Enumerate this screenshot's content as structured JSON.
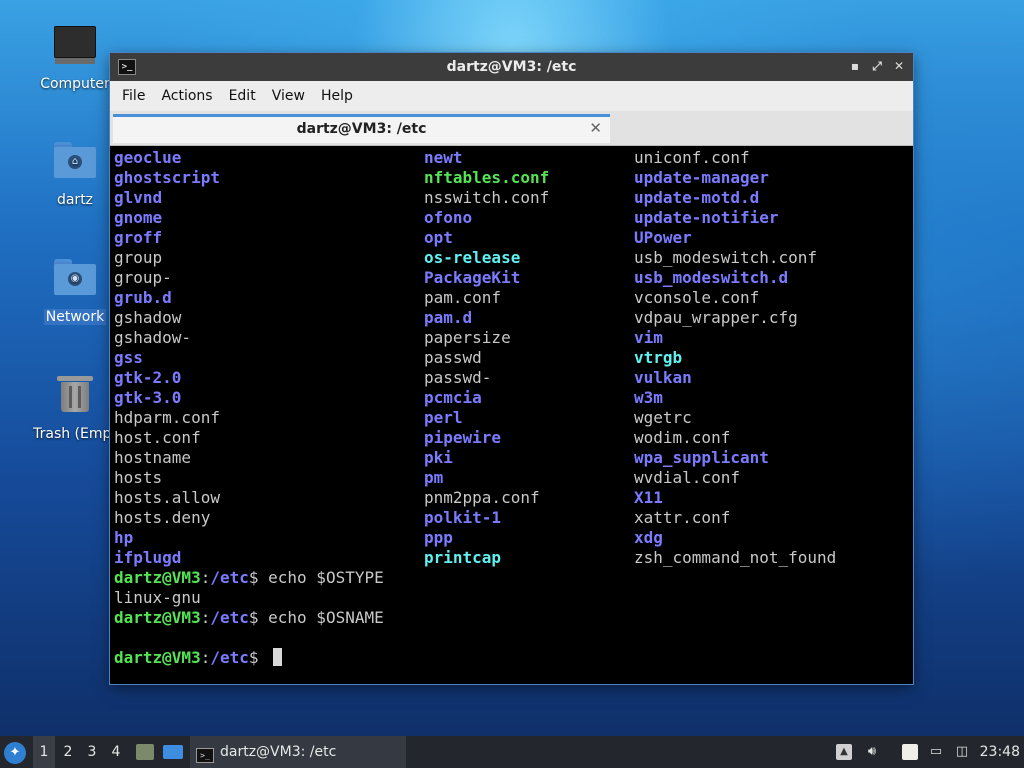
{
  "desktop": {
    "icons": [
      {
        "label": "Computer"
      },
      {
        "label": "dartz"
      },
      {
        "label": "Network"
      },
      {
        "label": "Trash (Empt"
      }
    ]
  },
  "window": {
    "title": "dartz@VM3: /etc",
    "controls": {
      "minimize": "▪",
      "maximize": "⤢",
      "close": "✕"
    },
    "menu": [
      "File",
      "Actions",
      "Edit",
      "View",
      "Help"
    ],
    "tab": {
      "title": "dartz@VM3: /etc",
      "close": "✕"
    }
  },
  "terminal": {
    "ls_columns": [
      [
        {
          "name": "geoclue",
          "type": "dir"
        },
        {
          "name": "ghostscript",
          "type": "dir"
        },
        {
          "name": "glvnd",
          "type": "dir"
        },
        {
          "name": "gnome",
          "type": "dir"
        },
        {
          "name": "groff",
          "type": "dir"
        },
        {
          "name": "group",
          "type": "file"
        },
        {
          "name": "group-",
          "type": "file"
        },
        {
          "name": "grub.d",
          "type": "dir"
        },
        {
          "name": "gshadow",
          "type": "file"
        },
        {
          "name": "gshadow-",
          "type": "file"
        },
        {
          "name": "gss",
          "type": "dir"
        },
        {
          "name": "gtk-2.0",
          "type": "dir"
        },
        {
          "name": "gtk-3.0",
          "type": "dir"
        },
        {
          "name": "hdparm.conf",
          "type": "file"
        },
        {
          "name": "host.conf",
          "type": "file"
        },
        {
          "name": "hostname",
          "type": "file"
        },
        {
          "name": "hosts",
          "type": "file"
        },
        {
          "name": "hosts.allow",
          "type": "file"
        },
        {
          "name": "hosts.deny",
          "type": "file"
        },
        {
          "name": "hp",
          "type": "dir"
        },
        {
          "name": "ifplugd",
          "type": "dir"
        }
      ],
      [
        {
          "name": "newt",
          "type": "dir"
        },
        {
          "name": "nftables.conf",
          "type": "exe"
        },
        {
          "name": "nsswitch.conf",
          "type": "file"
        },
        {
          "name": "ofono",
          "type": "dir"
        },
        {
          "name": "opt",
          "type": "dir"
        },
        {
          "name": "os-release",
          "type": "other"
        },
        {
          "name": "PackageKit",
          "type": "dir"
        },
        {
          "name": "pam.conf",
          "type": "file"
        },
        {
          "name": "pam.d",
          "type": "dir"
        },
        {
          "name": "papersize",
          "type": "file"
        },
        {
          "name": "passwd",
          "type": "file"
        },
        {
          "name": "passwd-",
          "type": "file"
        },
        {
          "name": "pcmcia",
          "type": "dir"
        },
        {
          "name": "perl",
          "type": "dir"
        },
        {
          "name": "pipewire",
          "type": "dir"
        },
        {
          "name": "pki",
          "type": "dir"
        },
        {
          "name": "pm",
          "type": "dir"
        },
        {
          "name": "pnm2ppa.conf",
          "type": "file"
        },
        {
          "name": "polkit-1",
          "type": "dir"
        },
        {
          "name": "ppp",
          "type": "dir"
        },
        {
          "name": "printcap",
          "type": "other"
        }
      ],
      [
        {
          "name": "uniconf.conf",
          "type": "file"
        },
        {
          "name": "update-manager",
          "type": "dir"
        },
        {
          "name": "update-motd.d",
          "type": "dir"
        },
        {
          "name": "update-notifier",
          "type": "dir"
        },
        {
          "name": "UPower",
          "type": "dir"
        },
        {
          "name": "usb_modeswitch.conf",
          "type": "file"
        },
        {
          "name": "usb_modeswitch.d",
          "type": "dir"
        },
        {
          "name": "vconsole.conf",
          "type": "file"
        },
        {
          "name": "vdpau_wrapper.cfg",
          "type": "file"
        },
        {
          "name": "vim",
          "type": "dir"
        },
        {
          "name": "vtrgb",
          "type": "other"
        },
        {
          "name": "vulkan",
          "type": "dir"
        },
        {
          "name": "w3m",
          "type": "dir"
        },
        {
          "name": "wgetrc",
          "type": "file"
        },
        {
          "name": "wodim.conf",
          "type": "file"
        },
        {
          "name": "wpa_supplicant",
          "type": "dir"
        },
        {
          "name": "wvdial.conf",
          "type": "file"
        },
        {
          "name": "X11",
          "type": "dir"
        },
        {
          "name": "xattr.conf",
          "type": "file"
        },
        {
          "name": "xdg",
          "type": "dir"
        },
        {
          "name": "zsh_command_not_found",
          "type": "file"
        }
      ]
    ],
    "prompt_user": "dartz@VM3",
    "prompt_sep": ":",
    "prompt_path": "/etc",
    "prompt_end": "$ ",
    "cmd1": "echo $OSTYPE",
    "out1": "linux-gnu",
    "cmd2": "echo $OSNAME",
    "out2": "",
    "cmd3": ""
  },
  "taskbar": {
    "start_icon": "menu-icon",
    "workspaces": [
      "1",
      "2",
      "3",
      "4"
    ],
    "active_workspace": "1",
    "task_label": "dartz@VM3: /etc",
    "clock": "23:48"
  },
  "colors": {
    "dir": "#7b7bff",
    "exe": "#54e454",
    "other": "#5ff0f0",
    "file": "#c8c8c8",
    "accent": "#4a90d9"
  }
}
